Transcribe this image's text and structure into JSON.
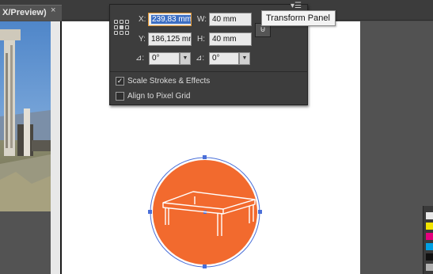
{
  "document_tab": {
    "title": "X/Preview)",
    "close_glyph": "×"
  },
  "transform_panel": {
    "menu_glyph": "▾☰",
    "x": {
      "label": "X:",
      "value": "239,83 mm"
    },
    "y": {
      "label": "Y:",
      "value": "186,125 mm"
    },
    "w": {
      "label": "W:",
      "value": "40 mm"
    },
    "h": {
      "label": "H:",
      "value": "40 mm"
    },
    "rotate": {
      "icon": "rotate-angle-icon",
      "glyph": "⊿:",
      "value": "0°"
    },
    "shear": {
      "icon": "shear-angle-icon",
      "glyph": "⊿:",
      "value": "0°"
    },
    "dropdown_glyph": "▼",
    "link_glyph": "⊍",
    "options": [
      {
        "label": "Scale Strokes & Effects",
        "checked": true,
        "glyph": "✓"
      },
      {
        "label": "Align to Pixel Grid",
        "checked": false,
        "glyph": ""
      }
    ]
  },
  "tooltip": {
    "text": "Transform Panel"
  },
  "artwork": {
    "circle_fill": "#f26a2e",
    "selection_color": "#4a6fd8",
    "table_icon": "table-icon"
  },
  "colors": {
    "accent_orange": "#f26a2e",
    "field_focus": "#e79a33",
    "selection_blue": "#3d6fc4"
  }
}
